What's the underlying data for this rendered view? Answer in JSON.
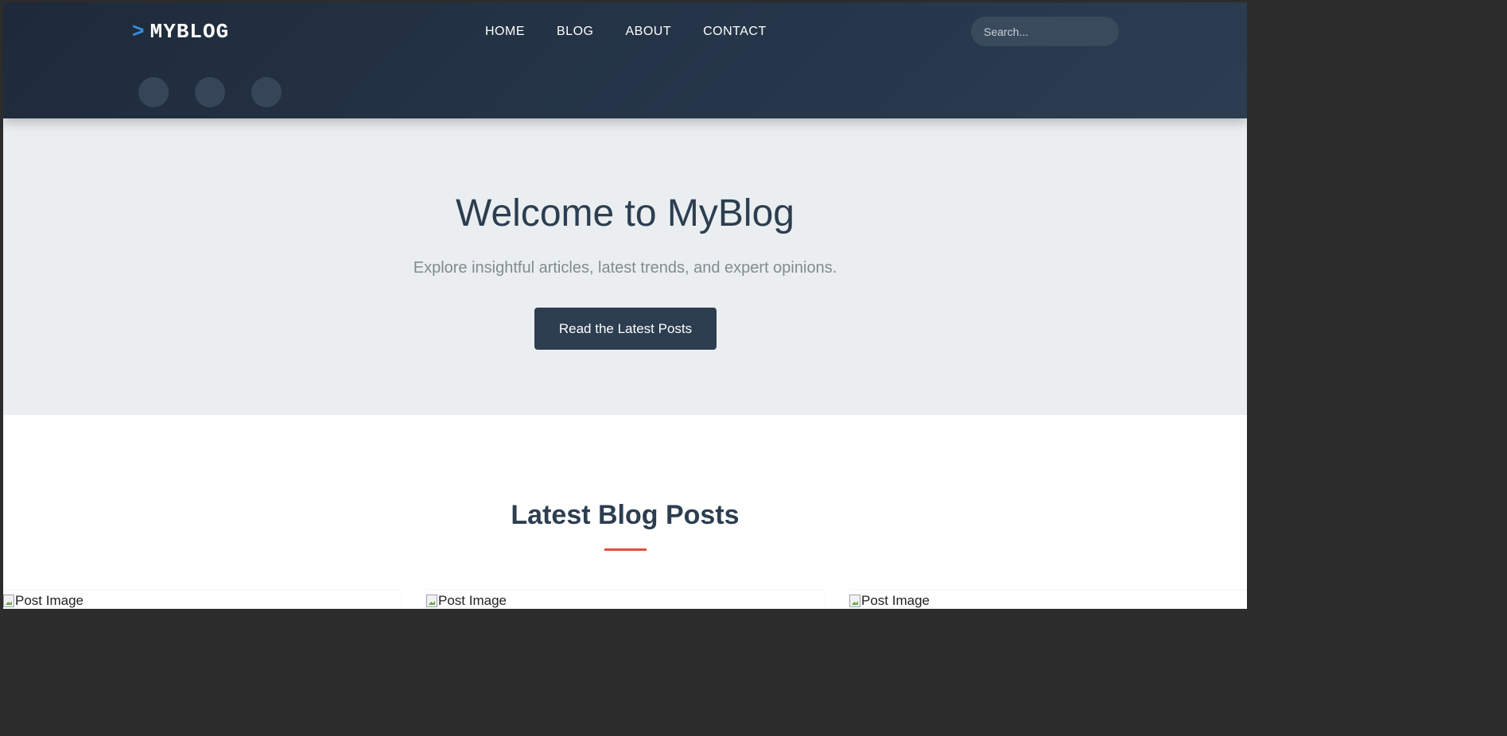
{
  "header": {
    "logo_chevron": ">",
    "logo_text": "MYBLOG",
    "nav": [
      {
        "label": "HOME"
      },
      {
        "label": "BLOG"
      },
      {
        "label": "ABOUT"
      },
      {
        "label": "CONTACT"
      }
    ],
    "search": {
      "placeholder": "Search...",
      "value": ""
    },
    "socials": [
      {
        "icon": "social-icon"
      },
      {
        "icon": "social-icon"
      },
      {
        "icon": "social-icon"
      }
    ]
  },
  "hero": {
    "title": "Welcome to MyBlog",
    "subtitle": "Explore insightful articles, latest trends, and expert opinions.",
    "button_label": "Read the Latest Posts"
  },
  "latest": {
    "title": "Latest Blog Posts",
    "posts": [
      {
        "image_alt": "Post Image"
      },
      {
        "image_alt": "Post Image"
      },
      {
        "image_alt": "Post Image"
      }
    ]
  },
  "colors": {
    "header_bg": "#1e2a3a",
    "accent_blue": "#3b8fe0",
    "hero_bg": "#ebeef0",
    "primary_dark": "#2c3e50",
    "underline_red": "#e74c3c"
  }
}
